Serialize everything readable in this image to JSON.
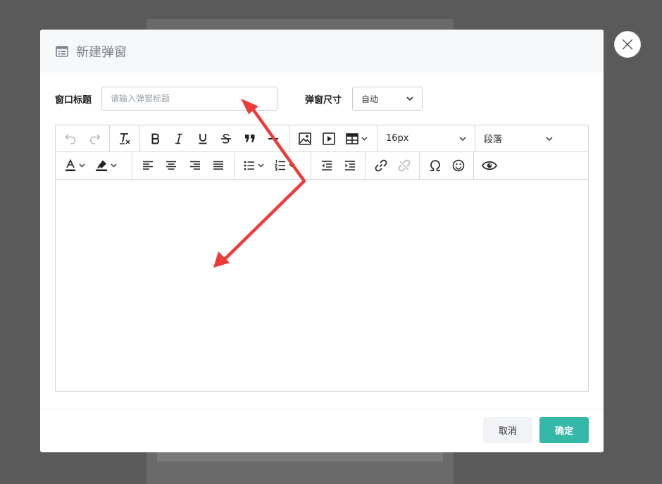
{
  "dialog": {
    "title": "新建弹窗",
    "title_label": "窗口标题",
    "title_placeholder": "请输入弹窗标题",
    "title_value": "",
    "size_label": "弹窗尺寸",
    "size_value": "自动",
    "cancel_label": "取消",
    "ok_label": "确定"
  },
  "toolbar": {
    "font_size": "16px",
    "block_format": "段落"
  },
  "colors": {
    "accent": "#34b8a7",
    "annotation": "#ef3a3a",
    "overlay": "#5a5a5a"
  }
}
